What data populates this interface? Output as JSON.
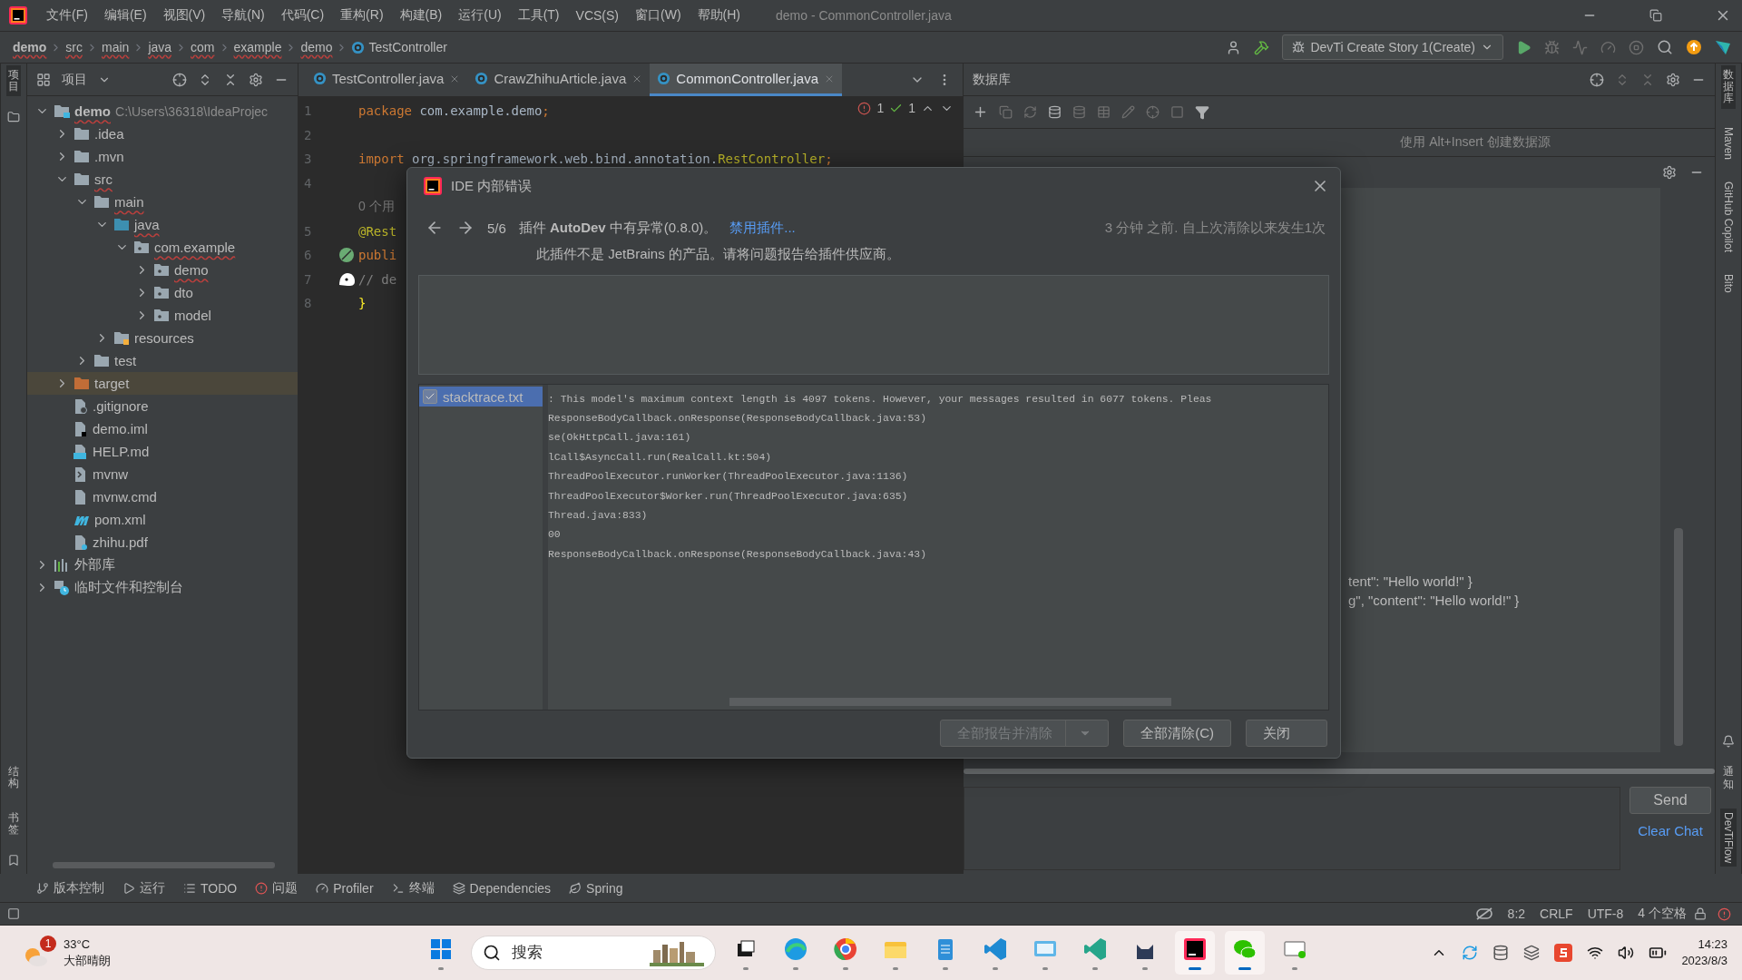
{
  "window": {
    "title": "demo - CommonController.java"
  },
  "menu": [
    "文件(F)",
    "编辑(E)",
    "视图(V)",
    "导航(N)",
    "代码(C)",
    "重构(R)",
    "构建(B)",
    "运行(U)",
    "工具(T)",
    "VCS(S)",
    "窗口(W)",
    "帮助(H)"
  ],
  "breadcrumbs": [
    {
      "label": "demo",
      "error": true,
      "kind": "module"
    },
    {
      "label": "src",
      "error": true,
      "kind": "dir"
    },
    {
      "label": "main",
      "error": true,
      "kind": "dir"
    },
    {
      "label": "java",
      "error": true,
      "kind": "dir"
    },
    {
      "label": "com",
      "error": true,
      "kind": "dir"
    },
    {
      "label": "example",
      "error": true,
      "kind": "dir"
    },
    {
      "label": "demo",
      "error": true,
      "kind": "dir"
    },
    {
      "label": "TestController",
      "error": false,
      "kind": "class"
    }
  ],
  "run_config": {
    "label": "DevTi Create Story 1(Create)"
  },
  "left_stripe": {
    "top": [
      {
        "label": "项目",
        "selected": true
      }
    ],
    "bottom": [
      {
        "label": "结构",
        "selected": false
      },
      {
        "label": "书签",
        "selected": false
      }
    ]
  },
  "project": {
    "title": "项目",
    "tree": [
      {
        "label": "demo",
        "detail": "C:\\Users\\36318\\IdeaProjec",
        "kind": "module",
        "expanded": true,
        "selected": false,
        "error": true,
        "children": [
          {
            "label": ".idea",
            "kind": "folder",
            "expanded": false,
            "selected": false,
            "error": false
          },
          {
            "label": ".mvn",
            "kind": "folder",
            "expanded": false,
            "selected": false,
            "error": false
          },
          {
            "label": "src",
            "kind": "folder",
            "expanded": true,
            "selected": false,
            "error": true,
            "children": [
              {
                "label": "main",
                "kind": "folder",
                "expanded": true,
                "selected": false,
                "error": true,
                "children": [
                  {
                    "label": "java",
                    "kind": "source",
                    "expanded": true,
                    "selected": false,
                    "error": true,
                    "children": [
                      {
                        "label": "com.example",
                        "kind": "package",
                        "expanded": true,
                        "selected": false,
                        "error": true,
                        "children": [
                          {
                            "label": "demo",
                            "kind": "package",
                            "expanded": false,
                            "selected": false,
                            "error": true
                          },
                          {
                            "label": "dto",
                            "kind": "package",
                            "expanded": false,
                            "selected": false,
                            "error": false
                          },
                          {
                            "label": "model",
                            "kind": "package",
                            "expanded": false,
                            "selected": false,
                            "error": false
                          }
                        ]
                      }
                    ]
                  },
                  {
                    "label": "resources",
                    "kind": "resources",
                    "expanded": false,
                    "selected": false,
                    "error": false
                  }
                ]
              },
              {
                "label": "test",
                "kind": "folder",
                "expanded": false,
                "selected": false,
                "error": false
              }
            ]
          },
          {
            "label": "target",
            "kind": "excluded",
            "expanded": false,
            "selected": true,
            "error": false
          },
          {
            "label": ".gitignore",
            "kind": "ignore",
            "selected": false,
            "error": false
          },
          {
            "label": "demo.iml",
            "kind": "iml",
            "selected": false,
            "error": false
          },
          {
            "label": "HELP.md",
            "kind": "markdown",
            "selected": false,
            "error": false
          },
          {
            "label": "mvnw",
            "kind": "shell",
            "selected": false,
            "error": false
          },
          {
            "label": "mvnw.cmd",
            "kind": "text",
            "selected": false,
            "error": false
          },
          {
            "label": "pom.xml",
            "kind": "maven",
            "selected": false,
            "error": false
          },
          {
            "label": "zhihu.pdf",
            "kind": "unknown",
            "selected": false,
            "error": false
          }
        ]
      },
      {
        "label": "外部库",
        "kind": "library",
        "expanded": false,
        "selected": false,
        "error": false
      },
      {
        "label": "临时文件和控制台",
        "kind": "scratch",
        "expanded": false,
        "selected": false,
        "error": false
      }
    ]
  },
  "editor_tabs": [
    {
      "label": "TestController.java",
      "selected": false
    },
    {
      "label": "CrawZhihuArticle.java",
      "selected": false
    },
    {
      "label": "CommonController.java",
      "selected": true
    }
  ],
  "editor": {
    "errors": "1",
    "warnings": "1",
    "lines": [
      {
        "number": "1",
        "segments": [
          {
            "text": "package",
            "kind": "keyword"
          },
          {
            "text": " com.example.demo",
            "kind": "plain"
          },
          {
            "text": ";",
            "kind": "keyword"
          }
        ]
      },
      {
        "number": "2",
        "kind": "code"
      },
      {
        "number": "3",
        "segments": [
          {
            "text": "import",
            "kind": "keyword"
          },
          {
            "text": " org.springframework.web.bind.annotation.",
            "kind": "plain"
          },
          {
            "text": "RestController",
            "kind": "annotation"
          },
          {
            "text": ";",
            "kind": "keyword"
          }
        ]
      },
      {
        "number": "4",
        "kind": "code"
      },
      {
        "segments": [
          {
            "text": "0 个用",
            "kind": "hint"
          }
        ]
      },
      {
        "number": "5",
        "segments": [
          {
            "text": "@Rest",
            "kind": "annotation"
          }
        ]
      },
      {
        "number": "6",
        "kind": "bean",
        "segments": [
          {
            "text": "publi",
            "kind": "keyword"
          }
        ]
      },
      {
        "number": "7",
        "kind": "ghost",
        "segments": [
          {
            "text": "// de",
            "kind": "comment"
          }
        ]
      },
      {
        "number": "8",
        "segments": [
          {
            "text": "}",
            "kind": "brace"
          }
        ]
      }
    ]
  },
  "database": {
    "title": "数据库",
    "hint": "使用 Alt+Insert 创建数据源"
  },
  "chat": {
    "messages": [
      "tent\": \"Hello world!\" }",
      "g\", \"content\": \"Hello world!\" }"
    ],
    "send": "Send",
    "clear": "Clear Chat"
  },
  "right_stripe": {
    "top": [
      {
        "label": "数据库",
        "kind": "cjk",
        "selected": true
      },
      {
        "label": "Maven",
        "kind": "latin",
        "selected": false
      },
      {
        "label": "GitHub Copilot",
        "kind": "latin",
        "selected": false
      },
      {
        "label": "Bito",
        "kind": "latin",
        "selected": false
      }
    ],
    "bottom": [
      {
        "label": "通知",
        "kind": "cjk",
        "selected": false
      },
      {
        "label": "DevTiFlow",
        "kind": "latin",
        "selected": true
      }
    ]
  },
  "tool_tabs": [
    {
      "label": "版本控制",
      "kind": "vcs"
    },
    {
      "label": "运行",
      "kind": "run"
    },
    {
      "label": "TODO",
      "kind": "todo"
    },
    {
      "label": "问题",
      "kind": "problems"
    },
    {
      "label": "Profiler",
      "kind": "profiler"
    },
    {
      "label": "终端",
      "kind": "terminal"
    },
    {
      "label": "Dependencies",
      "kind": "dependencies"
    },
    {
      "label": "Spring",
      "kind": "spring"
    }
  ],
  "status_bar": [
    "8:2",
    "CRLF",
    "UTF-8",
    "4 个空格"
  ],
  "dialog": {
    "title": "IDE 内部错误",
    "counter": "5/6",
    "message": "插件 **AutoDev** 中有异常(0.8.0)。",
    "link": "禁用插件...",
    "time": "3 分钟 之前. 自上次清除以来发生1次",
    "note": "此插件不是 JetBrains 的产品。请将问题报告给插件供应商。",
    "attachments": [
      {
        "label": "stacktrace.txt",
        "checked": true,
        "selected": true
      }
    ],
    "stacktrace": [
      ": This model's maximum context length is 4097 tokens. However, your messages resulted in 6077 tokens. Pleas",
      "ResponseBodyCallback.onResponse(ResponseBodyCallback.java:53)",
      "se(OkHttpCall.java:161)",
      "lCall$AsyncCall.run(RealCall.kt:504)",
      "ThreadPoolExecutor.runWorker(ThreadPoolExecutor.java:1136)",
      "ThreadPoolExecutor$Worker.run(ThreadPoolExecutor.java:635)",
      "Thread.java:833)",
      "00",
      "ResponseBodyCallback.onResponse(ResponseBodyCallback.java:43)"
    ],
    "buttons": [
      {
        "label": "全部报告并清除",
        "kind": "split",
        "disabled": true
      },
      {
        "label": "全部清除(C)",
        "kind": "plain",
        "disabled": false
      },
      {
        "label": "关闭",
        "kind": "plain",
        "disabled": false
      }
    ]
  },
  "taskbar": {
    "weather": {
      "temp": "33°C",
      "text": "大部晴朗",
      "badge": "1"
    },
    "search": {
      "placeholder": "搜索"
    },
    "time": "14:23",
    "date": "2023/8/3"
  }
}
